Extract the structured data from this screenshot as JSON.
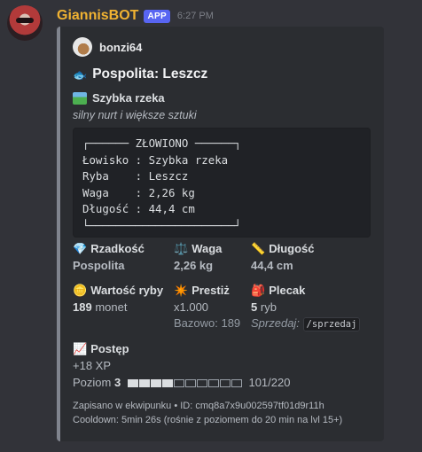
{
  "message": {
    "username": "GiannisBOT",
    "badge": "APP",
    "timestamp": "6:27 PM"
  },
  "embed": {
    "author": "bonzi64",
    "title": "Pospolita: Leszcz",
    "location_title": "Szybka rzeka",
    "location_desc": "silny nurt i większe sztuki",
    "code_lines": [
      "┌────── ZŁOWIONO ──────┐",
      "Łowisko : Szybka rzeka",
      "Ryba    : Leszcz",
      "Waga    : 2,26 kg",
      "Długość : 44,4 cm",
      "└──────────────────────┘"
    ],
    "fields": {
      "rarity_label": "Rzadkość",
      "rarity_value": "Pospolita",
      "weight_label": "Waga",
      "weight_value": "2,26 kg",
      "length_label": "Długość",
      "length_value": "44,4 cm",
      "value_label": "Wartość ryby",
      "value_number": "189",
      "value_unit": "monet",
      "prestige_label": "Prestiż",
      "prestige_value": "x1.000",
      "prestige_base": "Bazowo: 189",
      "backpack_label": "Plecak",
      "backpack_number": "5",
      "backpack_unit": "ryb",
      "backpack_sell_label": "Sprzedaj:",
      "backpack_sell_cmd": "/sprzedaj"
    },
    "progress": {
      "label": "Postęp",
      "xp": "+18 XP",
      "level_prefix": "Poziom",
      "level": "3",
      "segments_total": 10,
      "segments_filled": 4,
      "xp_progress": "101/220"
    },
    "footer_line1": "Zapisano w ekwipunku • ID: cmq8a7x9u002597tf01d9r11h",
    "footer_line2": "Cooldown: 5min 26s (rośnie z poziomem do 20 min na lvl 15+)"
  },
  "icons": {
    "fish": "fish-icon",
    "gem": "gem-icon",
    "scale": "scale-icon",
    "ruler": "ruler-icon",
    "coin": "coin-icon",
    "sparkle": "sparkle-icon",
    "backpack": "backpack-icon",
    "chart": "chart-increasing-icon"
  },
  "colors": {
    "username": "#f0b232",
    "badge": "#5865f2",
    "embed_border": "#80848e",
    "embed_bg": "#2b2d31"
  }
}
